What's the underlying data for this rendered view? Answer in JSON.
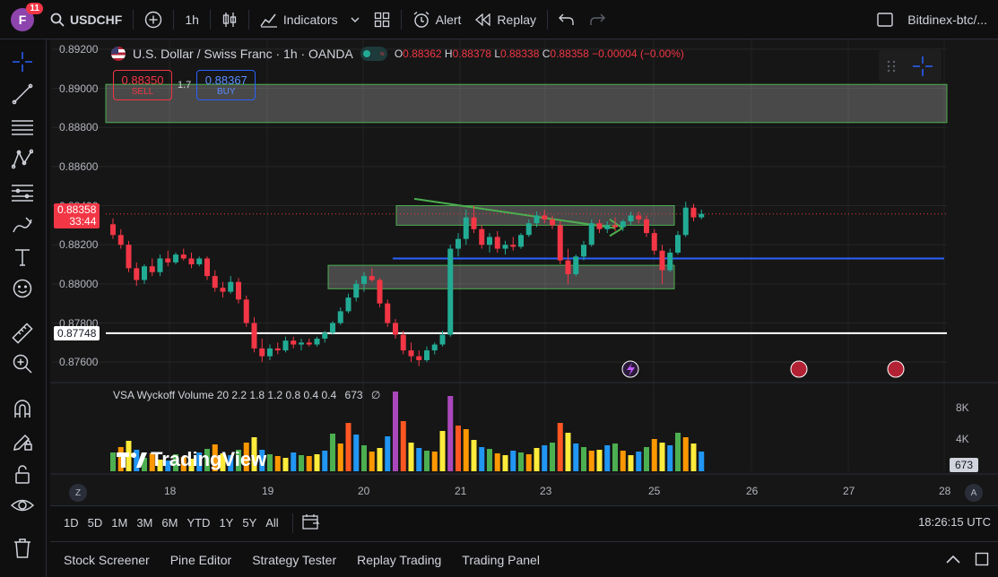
{
  "topbar": {
    "avatar_letter": "F",
    "notification_count": "11",
    "symbol": "USDCHF",
    "interval": "1h",
    "indicators_label": "Indicators",
    "alert_label": "Alert",
    "replay_label": "Replay",
    "layout_name": "Bitdinex-btc/..."
  },
  "legend": {
    "title": "U.S. Dollar / Swiss Franc · 1h · OANDA",
    "o_label": "O",
    "o": "0.88362",
    "h_label": "H",
    "h": "0.88378",
    "l_label": "L",
    "l": "0.88338",
    "c_label": "C",
    "c": "0.88358",
    "change": "−0.00004 (−0.00%)"
  },
  "trade": {
    "sell_price": "0.88350",
    "sell_label": "SELL",
    "spread": "1.7",
    "buy_price": "0.88367",
    "buy_label": "BUY"
  },
  "price_axis": {
    "labels": [
      "0.89200",
      "0.89000",
      "0.88800",
      "0.88600",
      "0.88400",
      "0.88200",
      "0.88000",
      "0.87800",
      "0.87600"
    ],
    "current_price": "0.88358",
    "countdown": "33:44",
    "line_price": "0.87748"
  },
  "time_axis": {
    "labels": [
      "18",
      "19",
      "20",
      "21",
      "23",
      "25",
      "26",
      "27",
      "28"
    ]
  },
  "volume": {
    "legend": "VSA Wyckoff Volume 20 2.2 1.8 1.2 0.8 0.4 0.4",
    "value": "673",
    "null_mark": "∅",
    "axis_labels": [
      "8K",
      "4K"
    ],
    "last_value_tag": "673"
  },
  "watermark": "TradingView",
  "scale_buttons": {
    "z": "Z",
    "a": "A"
  },
  "ranges": [
    "1D",
    "5D",
    "1M",
    "3M",
    "6M",
    "YTD",
    "1Y",
    "5Y",
    "All"
  ],
  "clock": "18:26:15 UTC",
  "bottom_tabs": [
    "Stock Screener",
    "Pine Editor",
    "Strategy Tester",
    "Replay Trading",
    "Trading Panel"
  ],
  "colors": {
    "up": "#22ab94",
    "down": "#f23645",
    "zone_fill": "rgba(255,255,255,0.22)",
    "zone_border": "#4caf50",
    "accent": "#2962ff"
  },
  "chart_data": {
    "type": "candlestick",
    "price_range": [
      0.875,
      0.8925
    ],
    "candles": [
      [
        0.88305,
        0.88335,
        0.8823,
        0.8825
      ],
      [
        0.8825,
        0.8828,
        0.8818,
        0.882
      ],
      [
        0.882,
        0.8822,
        0.8806,
        0.8808
      ],
      [
        0.8808,
        0.8811,
        0.8799,
        0.8802
      ],
      [
        0.8802,
        0.881,
        0.88,
        0.8809
      ],
      [
        0.8809,
        0.8813,
        0.8804,
        0.8806
      ],
      [
        0.8806,
        0.8815,
        0.8804,
        0.8813
      ],
      [
        0.8813,
        0.8817,
        0.8809,
        0.8811
      ],
      [
        0.8811,
        0.8816,
        0.881,
        0.8815
      ],
      [
        0.8815,
        0.8818,
        0.8812,
        0.8813
      ],
      [
        0.8813,
        0.8816,
        0.8808,
        0.881
      ],
      [
        0.881,
        0.8814,
        0.8809,
        0.8813
      ],
      [
        0.8813,
        0.8814,
        0.8802,
        0.8804
      ],
      [
        0.8804,
        0.8807,
        0.8796,
        0.8798
      ],
      [
        0.8798,
        0.8801,
        0.8793,
        0.8796
      ],
      [
        0.8796,
        0.8804,
        0.8795,
        0.8801
      ],
      [
        0.8801,
        0.8803,
        0.879,
        0.8792
      ],
      [
        0.8792,
        0.8794,
        0.8778,
        0.878
      ],
      [
        0.878,
        0.8783,
        0.8765,
        0.8767
      ],
      [
        0.8767,
        0.8772,
        0.876,
        0.8763
      ],
      [
        0.8763,
        0.8769,
        0.8761,
        0.8767
      ],
      [
        0.8767,
        0.877,
        0.8764,
        0.8766
      ],
      [
        0.8766,
        0.8773,
        0.8765,
        0.8771
      ],
      [
        0.8771,
        0.8773,
        0.8767,
        0.8769
      ],
      [
        0.8769,
        0.8772,
        0.8766,
        0.877
      ],
      [
        0.877,
        0.8772,
        0.8768,
        0.8769
      ],
      [
        0.8769,
        0.8773,
        0.8768,
        0.8772
      ],
      [
        0.8772,
        0.8776,
        0.877,
        0.8775
      ],
      [
        0.8775,
        0.8781,
        0.8774,
        0.878
      ],
      [
        0.878,
        0.8788,
        0.8779,
        0.8786
      ],
      [
        0.8786,
        0.8795,
        0.8785,
        0.8793
      ],
      [
        0.8793,
        0.8802,
        0.8791,
        0.88
      ],
      [
        0.88,
        0.8806,
        0.8796,
        0.8804
      ],
      [
        0.8804,
        0.8808,
        0.8801,
        0.8802
      ],
      [
        0.8802,
        0.8803,
        0.8788,
        0.879
      ],
      [
        0.879,
        0.8792,
        0.8778,
        0.878
      ],
      [
        0.878,
        0.8782,
        0.8772,
        0.8774
      ],
      [
        0.8774,
        0.8776,
        0.8764,
        0.8766
      ],
      [
        0.8766,
        0.877,
        0.876,
        0.8763
      ],
      [
        0.8763,
        0.8766,
        0.8758,
        0.8761
      ],
      [
        0.8761,
        0.8768,
        0.876,
        0.8766
      ],
      [
        0.8766,
        0.877,
        0.8764,
        0.8769
      ],
      [
        0.8769,
        0.8776,
        0.8768,
        0.8774
      ],
      [
        0.8774,
        0.882,
        0.8773,
        0.8818
      ],
      [
        0.8818,
        0.8826,
        0.8814,
        0.8823
      ],
      [
        0.8823,
        0.8838,
        0.882,
        0.8834
      ],
      [
        0.8834,
        0.884,
        0.8826,
        0.8828
      ],
      [
        0.8828,
        0.883,
        0.8818,
        0.882
      ],
      [
        0.882,
        0.8826,
        0.8816,
        0.8824
      ],
      [
        0.8824,
        0.8827,
        0.8816,
        0.8818
      ],
      [
        0.8818,
        0.8822,
        0.8815,
        0.882
      ],
      [
        0.882,
        0.8824,
        0.8817,
        0.8819
      ],
      [
        0.8819,
        0.8826,
        0.8818,
        0.8825
      ],
      [
        0.8825,
        0.8833,
        0.8824,
        0.8831
      ],
      [
        0.8831,
        0.8837,
        0.8829,
        0.8835
      ],
      [
        0.8835,
        0.8838,
        0.8831,
        0.8833
      ],
      [
        0.8833,
        0.8835,
        0.8828,
        0.883
      ],
      [
        0.883,
        0.8832,
        0.881,
        0.8812
      ],
      [
        0.8812,
        0.8818,
        0.88,
        0.8805
      ],
      [
        0.8805,
        0.8815,
        0.8804,
        0.8814
      ],
      [
        0.8814,
        0.8822,
        0.8812,
        0.882
      ],
      [
        0.882,
        0.8833,
        0.8819,
        0.8831
      ],
      [
        0.8831,
        0.8833,
        0.8826,
        0.8828
      ],
      [
        0.8828,
        0.8832,
        0.8826,
        0.883
      ],
      [
        0.883,
        0.8834,
        0.8827,
        0.8829
      ],
      [
        0.8829,
        0.8833,
        0.8827,
        0.8832
      ],
      [
        0.8832,
        0.8837,
        0.883,
        0.8835
      ],
      [
        0.8835,
        0.8837,
        0.8831,
        0.8833
      ],
      [
        0.8833,
        0.8835,
        0.8824,
        0.8826
      ],
      [
        0.8826,
        0.8828,
        0.8815,
        0.8817
      ],
      [
        0.8817,
        0.882,
        0.88,
        0.8807
      ],
      [
        0.8807,
        0.8818,
        0.8806,
        0.8816
      ],
      [
        0.8816,
        0.8827,
        0.8815,
        0.8825
      ],
      [
        0.8825,
        0.8842,
        0.8824,
        0.8839
      ],
      [
        0.8839,
        0.8841,
        0.8832,
        0.8834
      ],
      [
        0.8834,
        0.8838,
        0.8833,
        0.88358
      ]
    ],
    "volume_range": [
      0,
      9000
    ],
    "volumes": [
      2100,
      2700,
      3400,
      2400,
      1500,
      2000,
      1300,
      1200,
      1900,
      1600,
      1400,
      2100,
      2500,
      3000,
      2000,
      1800,
      2400,
      3200,
      3800,
      2400,
      1900,
      1700,
      1500,
      2100,
      1800,
      1700,
      1900,
      2300,
      4200,
      3100,
      5400,
      4100,
      2900,
      2200,
      2600,
      3900,
      8900,
      5600,
      3200,
      2600,
      2300,
      2200,
      4500,
      8400,
      5100,
      4700,
      3500,
      2700,
      2500,
      2000,
      1800,
      2300,
      2100,
      1900,
      2600,
      2900,
      3200,
      5400,
      4300,
      3100,
      2700,
      2300,
      2400,
      2900,
      3100,
      2300,
      1800,
      2200,
      2700,
      3600,
      3200,
      2900,
      4300,
      3800,
      3100,
      2200
    ]
  }
}
